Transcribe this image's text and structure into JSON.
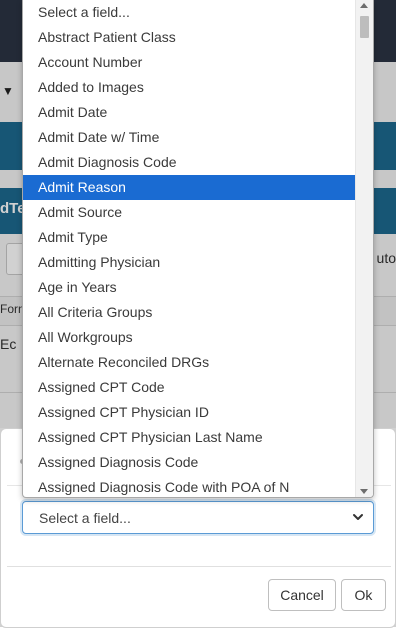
{
  "background": {
    "band_text": "dTe",
    "auto_text": "uto",
    "form_text": "Forn",
    "edit_text": "Ec"
  },
  "modal": {
    "select": {
      "value": "Select a field..."
    },
    "buttons": {
      "cancel": "Cancel",
      "ok": "Ok"
    }
  },
  "dropdown": {
    "selected_index": 7,
    "options": [
      "Select a field...",
      "Abstract Patient Class",
      "Account Number",
      "Added to Images",
      "Admit Date",
      "Admit Date w/ Time",
      "Admit Diagnosis Code",
      "Admit Reason",
      "Admit Source",
      "Admit Type",
      "Admitting Physician",
      "Age in Years",
      "All Criteria Groups",
      "All Workgroups",
      "Alternate Reconciled DRGs",
      "Assigned CPT Code",
      "Assigned CPT Physician ID",
      "Assigned CPT Physician Last Name",
      "Assigned Diagnosis Code",
      "Assigned Diagnosis Code with POA of N"
    ]
  },
  "colors": {
    "selected_bg": "#1a6bd2",
    "band": "#1d6a8f",
    "topbar": "#2b3444"
  }
}
